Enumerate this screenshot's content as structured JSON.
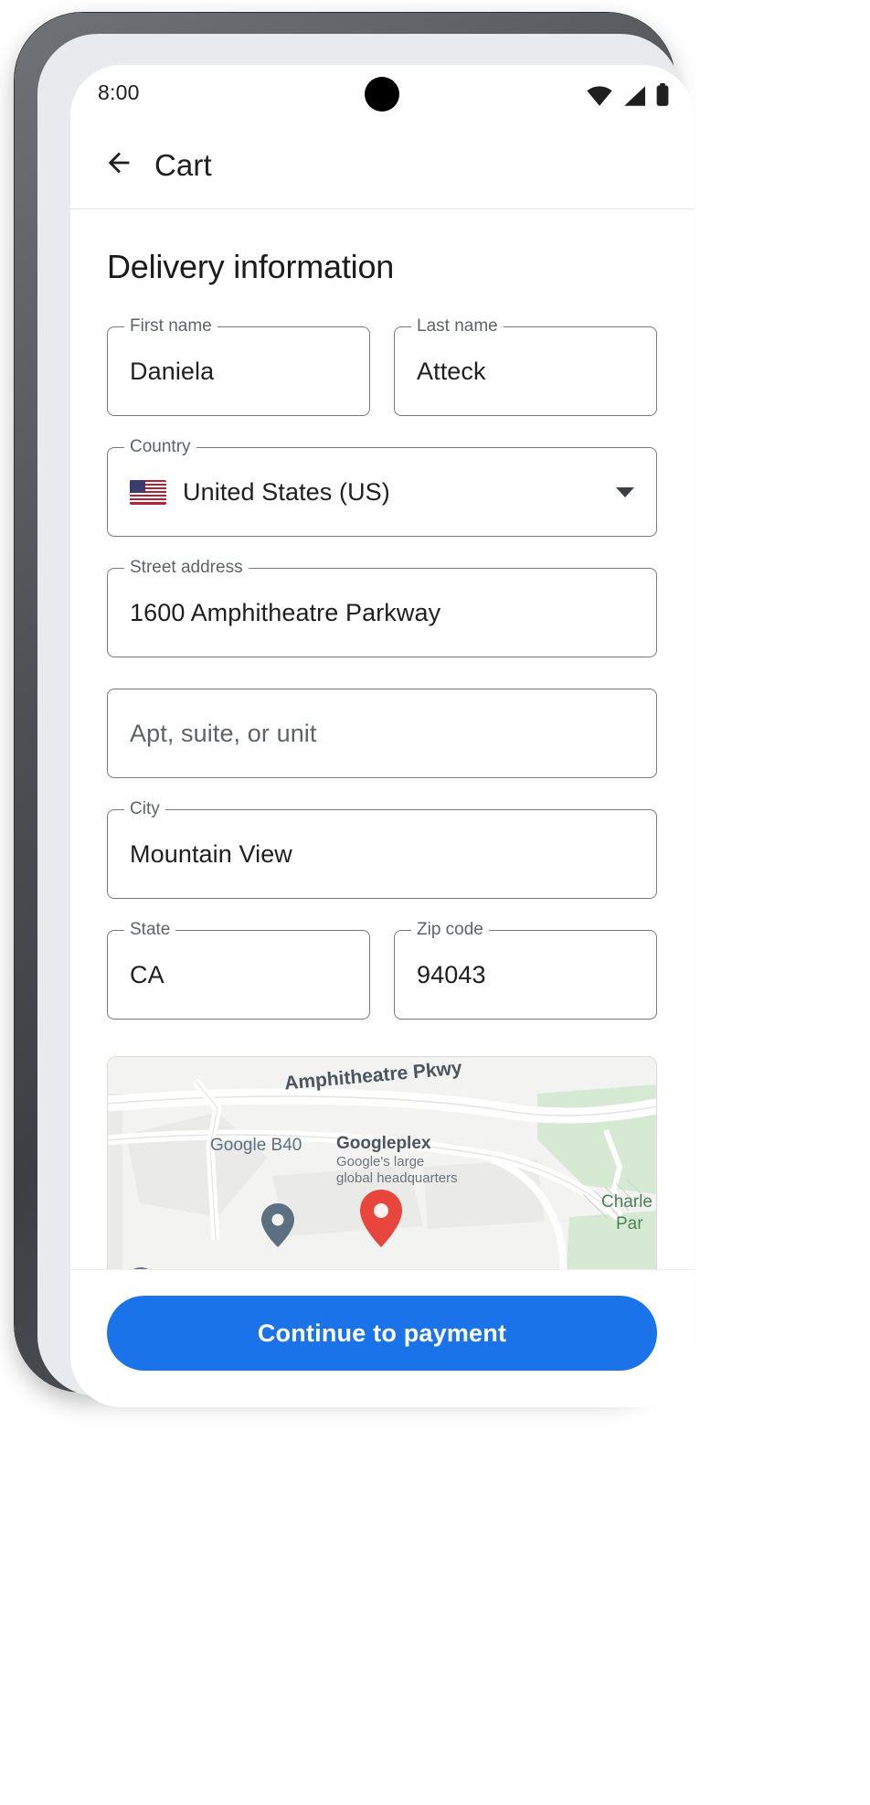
{
  "status_bar": {
    "time": "8:00",
    "icons": [
      "wifi-icon",
      "cell-signal-icon",
      "battery-icon"
    ]
  },
  "app_bar": {
    "back_icon": "arrow-back-icon",
    "title": "Cart"
  },
  "main": {
    "section_title": "Delivery information",
    "fields": [
      {
        "key": "first_name",
        "label": "First name",
        "value": "Daniela",
        "placeholder": ""
      },
      {
        "key": "last_name",
        "label": "Last name",
        "value": "Atteck",
        "placeholder": ""
      },
      {
        "key": "country",
        "label": "Country",
        "value": "United States (US)",
        "placeholder": "",
        "flag": "us-flag-icon",
        "has_dropdown": true
      },
      {
        "key": "street_address",
        "label": "Street address",
        "value": "1600 Amphitheatre Parkway",
        "placeholder": ""
      },
      {
        "key": "apt",
        "label": "",
        "value": "",
        "placeholder": "Apt, suite, or unit"
      },
      {
        "key": "city",
        "label": "City",
        "value": "Mountain View",
        "placeholder": ""
      },
      {
        "key": "state",
        "label": "State",
        "value": "CA",
        "placeholder": ""
      },
      {
        "key": "zip",
        "label": "Zip code",
        "value": "94043",
        "placeholder": ""
      }
    ],
    "map": {
      "street_label": "Amphitheatre Pkwy",
      "poi_b40": "Google B40",
      "poi_googleplex": "Googleplex",
      "poi_googleplex_sub_1": "Google's large",
      "poi_googleplex_sub_2": "global headquarters",
      "park_label_1": "Charle",
      "park_label_2": "Par"
    }
  },
  "footer": {
    "cta_label": "Continue to payment"
  },
  "colors": {
    "accent": "#1a73e8",
    "marker_red": "#e8453c",
    "marker_blue": "#5b7083",
    "text_primary": "#1f1f1f",
    "text_secondary": "#5f6368",
    "field_border": "#79797d",
    "map_park": "#d6ead3",
    "map_bg": "#f3f4f2"
  }
}
